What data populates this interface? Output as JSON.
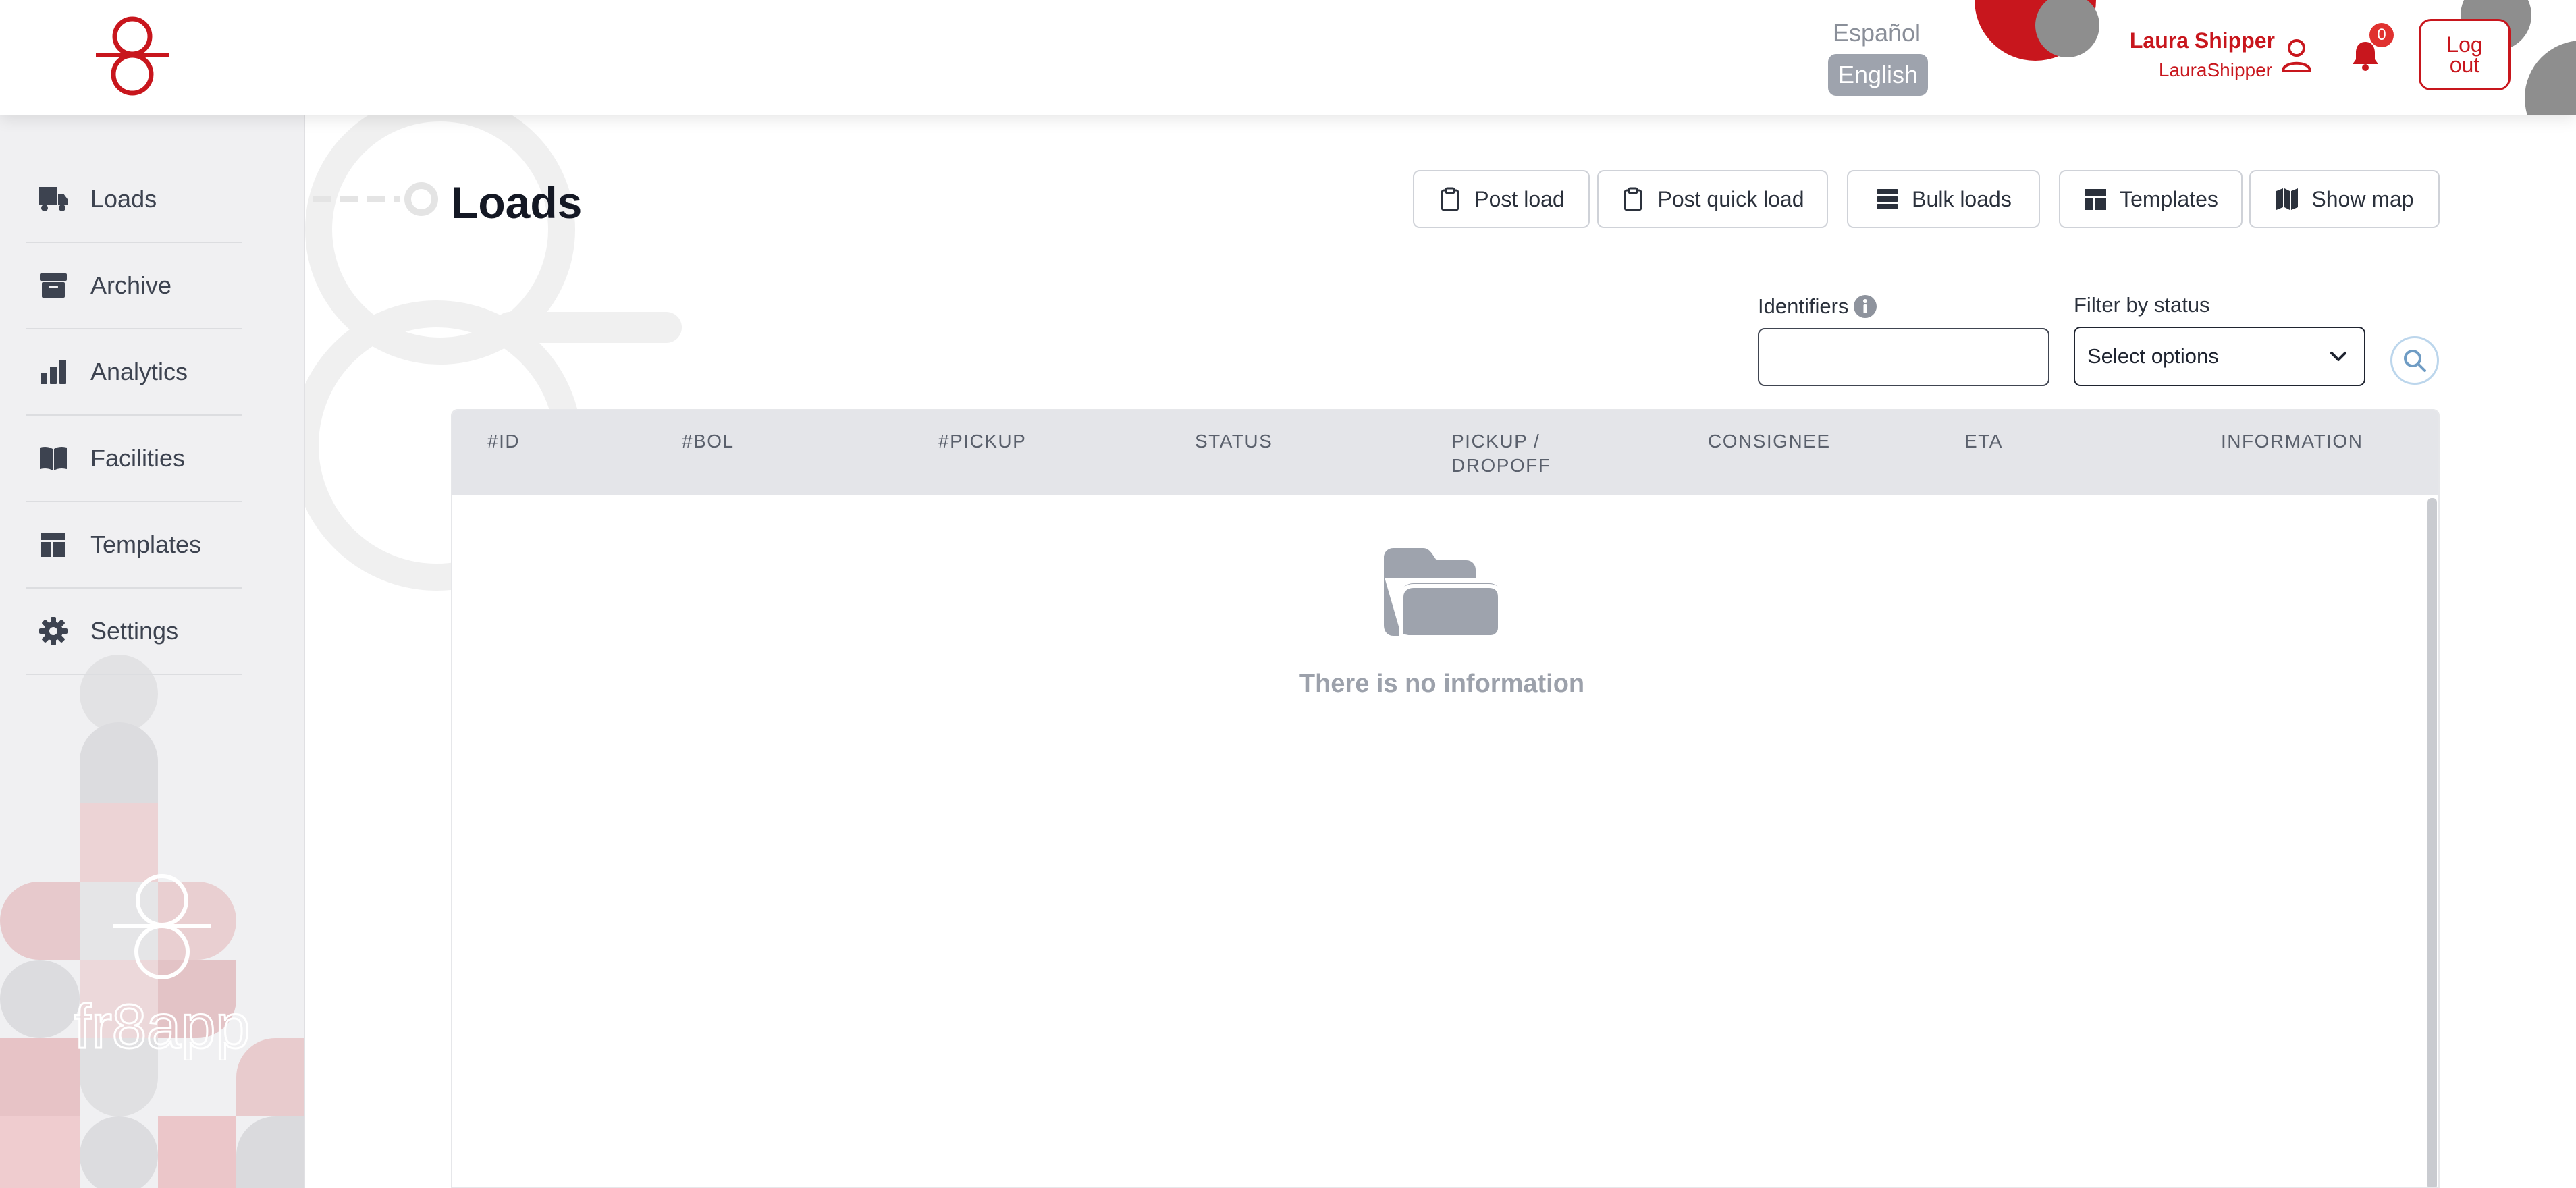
{
  "header": {
    "lang_es": "Español",
    "lang_en": "English",
    "user_name": "Laura Shipper",
    "user_handle": "LauraShipper",
    "notification_count": "0",
    "logout_label": "Log out"
  },
  "sidebar": {
    "items": [
      {
        "label": "Loads",
        "icon": "truck-icon"
      },
      {
        "label": "Archive",
        "icon": "archive-box-icon"
      },
      {
        "label": "Analytics",
        "icon": "bar-chart-icon"
      },
      {
        "label": "Facilities",
        "icon": "book-icon"
      },
      {
        "label": "Templates",
        "icon": "template-layout-icon"
      },
      {
        "label": "Settings",
        "icon": "gear-icon"
      }
    ],
    "brand": "fr8app"
  },
  "main": {
    "title": "Loads",
    "buttons": {
      "post_load": "Post load",
      "post_quick_load": "Post quick load",
      "bulk_loads": "Bulk loads",
      "templates": "Templates",
      "show_map": "Show map"
    },
    "filters": {
      "identifiers_label": "Identifiers",
      "identifiers_value": "",
      "status_label": "Filter by status",
      "status_placeholder": "Select options"
    },
    "table": {
      "columns": [
        "#ID",
        "#BOL",
        "#PICKUP",
        "STATUS",
        "PICKUP / DROPOFF",
        "CONSIGNEE",
        "ETA",
        "INFORMATION"
      ],
      "rows": [],
      "empty_message": "There is no information"
    }
  },
  "colors": {
    "brand_red": "#c8161d",
    "badge_red": "#e0312f",
    "sidebar_bg": "#f0f0f2",
    "table_header_bg": "#e4e5e9"
  }
}
